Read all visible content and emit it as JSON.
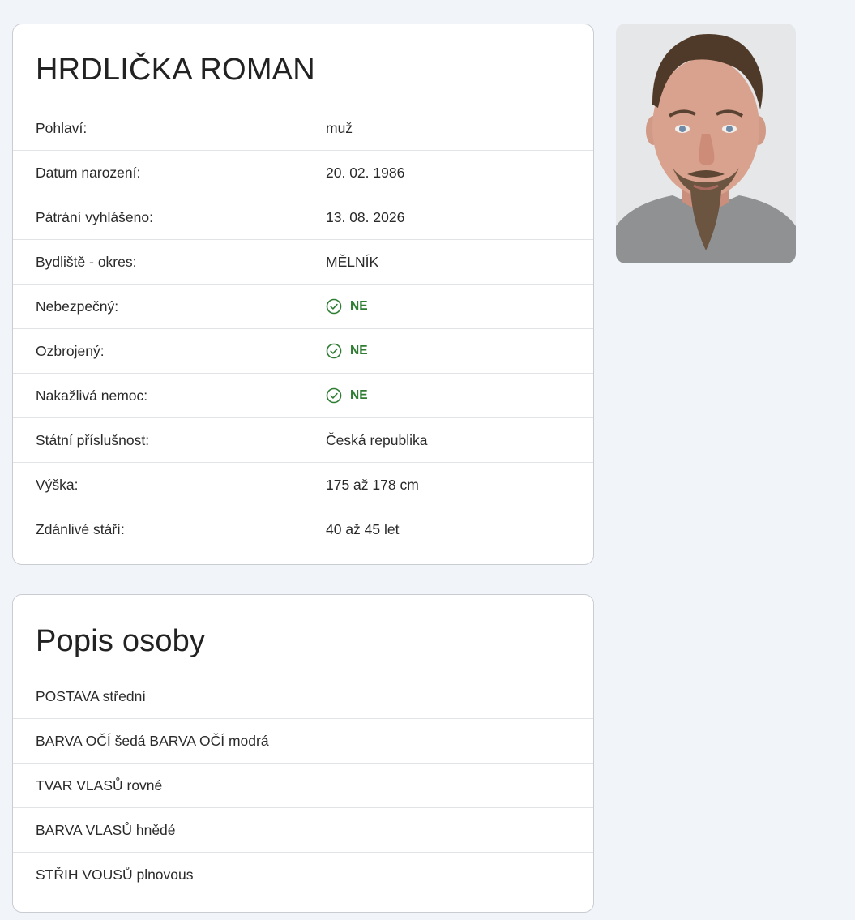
{
  "person": {
    "name": "HRDLIČKA ROMAN",
    "details": [
      {
        "label": "Pohlaví:",
        "value": "muž",
        "type": "text"
      },
      {
        "label": "Datum narození:",
        "value": "20. 02. 1986",
        "type": "text"
      },
      {
        "label": "Pátrání vyhlášeno:",
        "value": "13. 08. 2026",
        "type": "text"
      },
      {
        "label": "Bydliště - okres:",
        "value": "MĚLNÍK",
        "type": "text"
      },
      {
        "label": "Nebezpečný:",
        "value": "NE",
        "type": "flag",
        "icon": "check-circle-icon"
      },
      {
        "label": "Ozbrojený:",
        "value": "NE",
        "type": "flag",
        "icon": "check-circle-icon"
      },
      {
        "label": "Nakažlivá nemoc:",
        "value": "NE",
        "type": "flag",
        "icon": "check-circle-icon"
      },
      {
        "label": "Státní příslušnost:",
        "value": "Česká republika",
        "type": "text"
      },
      {
        "label": "Výška:",
        "value": "175 až 178 cm",
        "type": "text"
      },
      {
        "label": "Zdánlivé stáří:",
        "value": "40 až 45 let",
        "type": "text"
      }
    ]
  },
  "description": {
    "title": "Popis osoby",
    "items": [
      "POSTAVA střední",
      "BARVA OČÍ šedá BARVA OČÍ modrá",
      "TVAR VLASŮ rovné",
      "BARVA VLASŮ hnědé",
      "STŘIH VOUSŮ plnovous"
    ]
  },
  "colors": {
    "page_background": "#f1f4f9",
    "card_border": "#c9ccd1",
    "flag_green": "#2e7d32"
  },
  "photo": {
    "icon": "person-photo"
  }
}
